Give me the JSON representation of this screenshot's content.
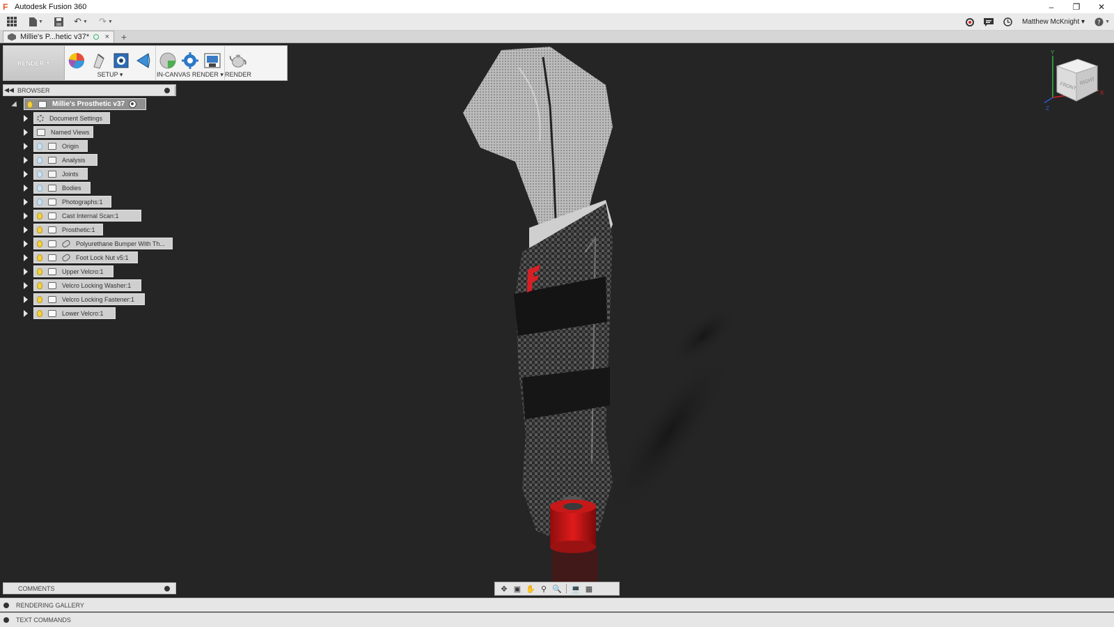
{
  "window": {
    "title": "Autodesk Fusion 360",
    "controls": [
      "minimize",
      "restore",
      "close"
    ]
  },
  "qat": {
    "user_name": "Matthew McKnight",
    "help_label": "?"
  },
  "document_tab": {
    "title": "Millie's P...hetic v37*",
    "close_label": "×",
    "new_tab_label": "+"
  },
  "ribbon": {
    "workspace_label": "RENDER",
    "setup_label": "SETUP",
    "in_canvas_label": "IN-CANVAS RENDER",
    "render_label": "RENDER"
  },
  "browser": {
    "header": "BROWSER",
    "root": "Millie's Prosthetic v37",
    "items": [
      {
        "label": "Document Settings",
        "icon": "gear-icon"
      },
      {
        "label": "Named Views",
        "icon": "folder-icon"
      },
      {
        "label": "Origin",
        "icon": "folder-icon"
      },
      {
        "label": "Analysis",
        "icon": "folder-icon"
      },
      {
        "label": "Joints",
        "icon": "folder-icon"
      },
      {
        "label": "Bodies",
        "icon": "folder-icon"
      },
      {
        "label": "Photographs:1",
        "icon": "component-icon"
      },
      {
        "label": "Cast Internal Scan:1",
        "icon": "component-icon"
      },
      {
        "label": "Prosthetic:1",
        "icon": "component-icon"
      },
      {
        "label": "Polyurethane Bumper With Th...",
        "icon": "linked-component-icon"
      },
      {
        "label": "Foot Lock Nut v5:1",
        "icon": "linked-component-icon"
      },
      {
        "label": "Upper Velcro:1",
        "icon": "component-icon"
      },
      {
        "label": "Velcro Locking Washer:1",
        "icon": "component-icon"
      },
      {
        "label": "Velcro Locking Fastener:1",
        "icon": "component-icon"
      },
      {
        "label": "Lower Velcro:1",
        "icon": "component-icon"
      }
    ]
  },
  "viewcube": {
    "face_front": "FRONT",
    "face_right": "RIGHT",
    "axis_x": "X",
    "axis_y": "Y",
    "axis_z": "Z"
  },
  "panels": {
    "comments": "COMMENTS",
    "rendering_gallery": "RENDERING GALLERY",
    "text_commands": "TEXT COMMANDS"
  },
  "colors": {
    "canvas_bg": "#252525",
    "accent_red": "#d81f26",
    "fusion_orange": "#e8551f"
  }
}
